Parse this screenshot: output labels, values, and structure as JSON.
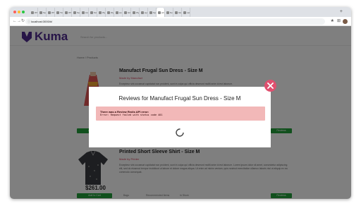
{
  "browser": {
    "tabs": [
      {
        "label": "Who"
      },
      {
        "label": "Seon"
      },
      {
        "label": "Who"
      },
      {
        "label": "Tires"
      },
      {
        "label": "Who"
      },
      {
        "label": "Secre"
      },
      {
        "label": "Ann"
      },
      {
        "label": "Scree"
      },
      {
        "label": "Wyco"
      },
      {
        "label": "Wyco"
      },
      {
        "label": "works"
      },
      {
        "label": "GitH"
      },
      {
        "label": "Wyns"
      },
      {
        "label": "wyns"
      },
      {
        "label": "Spee"
      },
      {
        "label": "wh"
      },
      {
        "label": "Nolo"
      },
      {
        "label": "Glas"
      },
      {
        "label": "Lates"
      }
    ],
    "active_tab_index": 15,
    "url": "localhost:3000/#/",
    "new_tab_glyph": "+"
  },
  "header": {
    "logo_text": "Kuma",
    "search_placeholder": "Search for products..."
  },
  "breadcrumb": "Home / Products",
  "products": [
    {
      "title": "Manufact Frugal Sun Dress - Size M",
      "subtitle": "Made by Manufact",
      "description": "Excepteur sint occaecat cupidatat non proident, sunt in culpa qui officia deserunt mollit anim id est laborum.",
      "add_label": "Add to Cart",
      "review_label": "Reviews"
    },
    {
      "title": "Printed Short Sleeve Shirt - Size M",
      "subtitle": "Made by Printer",
      "description": "Excepteur sint occaecat cupidatat non proident, sunt in culpa qui officia deserunt mollit anim id est laborum. Lorem ipsum dolor sit amet, consectetur adipiscing elit, sed do eiusmod tempor incididunt ut labore et dolore magna aliqua. Ut enim ad minim veniam, quis nostrud exercitation ullamco laboris nisi ut aliquip ex ea commodo consequat.",
      "price": "$261.00",
      "add_label": "Add to Cart",
      "review_label": "Reviews",
      "meta": [
        "Bags",
        "Recommended Items",
        "In Stock"
      ]
    }
  ],
  "modal": {
    "title": "Reviews for Manufact Frugal Sun Dress - Size M",
    "error_heading": "There was a Review Redis API error:",
    "error_message": "Error: Request failed with status code 401",
    "close_icon": "close-icon",
    "spinner_icon": "loading-spinner-icon"
  },
  "colors": {
    "brand": "#4e2a8e",
    "button": "#22a03a",
    "error_bg": "#f2b8b8",
    "close": "#e0506f",
    "accent_text": "#d43f5b"
  }
}
